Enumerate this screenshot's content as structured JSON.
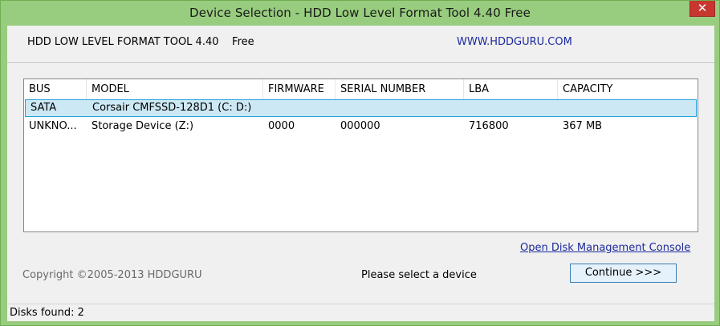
{
  "window": {
    "title": "Device Selection - HDD Low Level Format Tool 4.40    Free",
    "close_glyph": "✕"
  },
  "header": {
    "app_name": "HDD LOW LEVEL FORMAT TOOL 4.40    Free",
    "website": "WWW.HDDGURU.COM"
  },
  "device_list": {
    "columns": [
      "BUS",
      "MODEL",
      "FIRMWARE",
      "SERIAL NUMBER",
      "LBA",
      "CAPACITY"
    ],
    "rows": [
      [
        "SATA",
        "Corsair CMFSSD-128D1 (C: D:)",
        "",
        "",
        "",
        ""
      ],
      [
        "UNKNO...",
        "Storage Device (Z:)",
        "0000",
        "000000",
        "716800",
        "367 MB"
      ]
    ],
    "selected_row": 0
  },
  "links": {
    "disk_management": "Open Disk Management Console"
  },
  "footer": {
    "copyright": "Copyright ©2005-2013 HDDGURU",
    "status_message": "Please select a device",
    "continue_label": "Continue >>>"
  },
  "statusbar": {
    "disks_found": "Disks found: 2"
  },
  "colors": {
    "window_frame": "#98cc7e",
    "selection_fill": "#cce8f4",
    "selection_border": "#26a0da",
    "link": "#1c2a9e",
    "close_button": "#c7372f"
  }
}
